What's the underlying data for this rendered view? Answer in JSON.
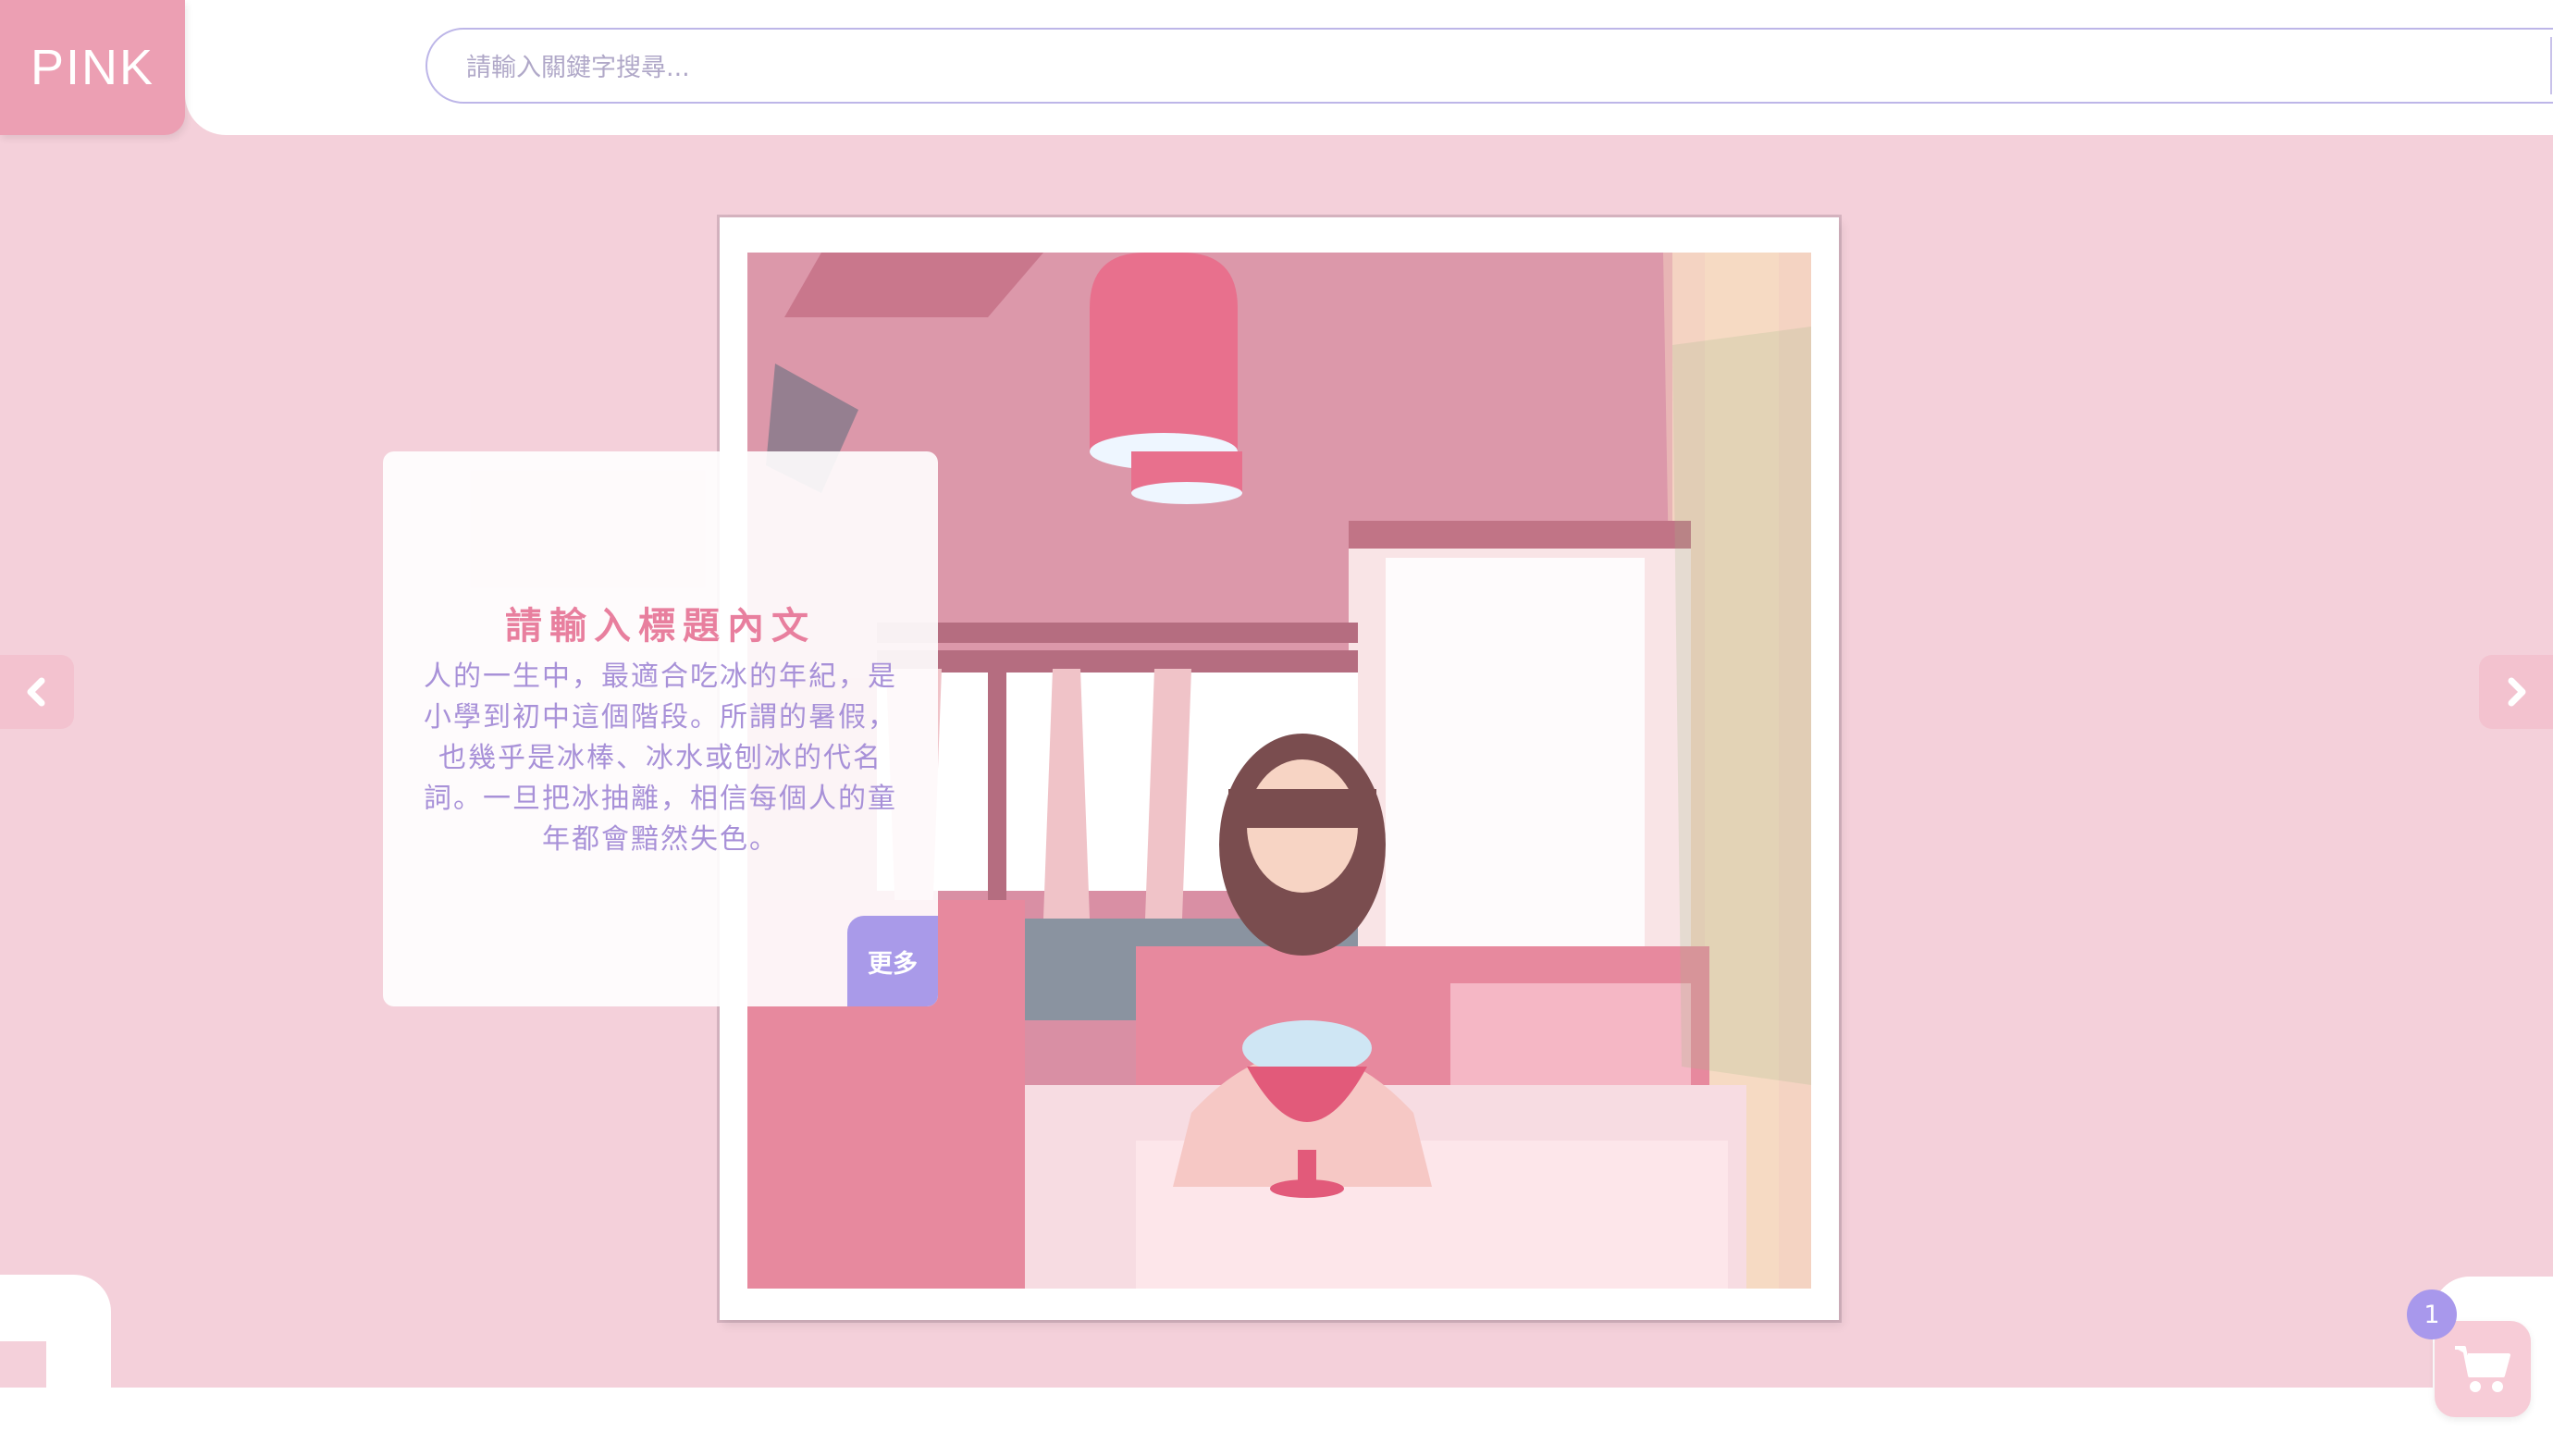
{
  "brand": {
    "logo": "PINK"
  },
  "search": {
    "placeholder": "請輸入關鍵字搜尋...",
    "value": "",
    "icon": "search-icon"
  },
  "hero": {
    "title": "請輸入標題內文",
    "body": "人的一生中，最適合吃冰的年紀，是小學到初中這個階段。所謂的暑假，也幾乎是冰棒、冰水或刨冰的代名詞。一旦把冰抽離，相信每個人的童年都會黯然失色。",
    "more_label": "更多",
    "prev_icon": "chevron-left-icon",
    "next_icon": "chevron-right-icon"
  },
  "cart": {
    "count": "1",
    "icon": "shopping-cart-icon"
  },
  "colors": {
    "background": "#f4d0da",
    "logo": "#ec9fb3",
    "accent": "#a99ae9",
    "title": "#e87f9e",
    "body_text": "#a891d8"
  }
}
